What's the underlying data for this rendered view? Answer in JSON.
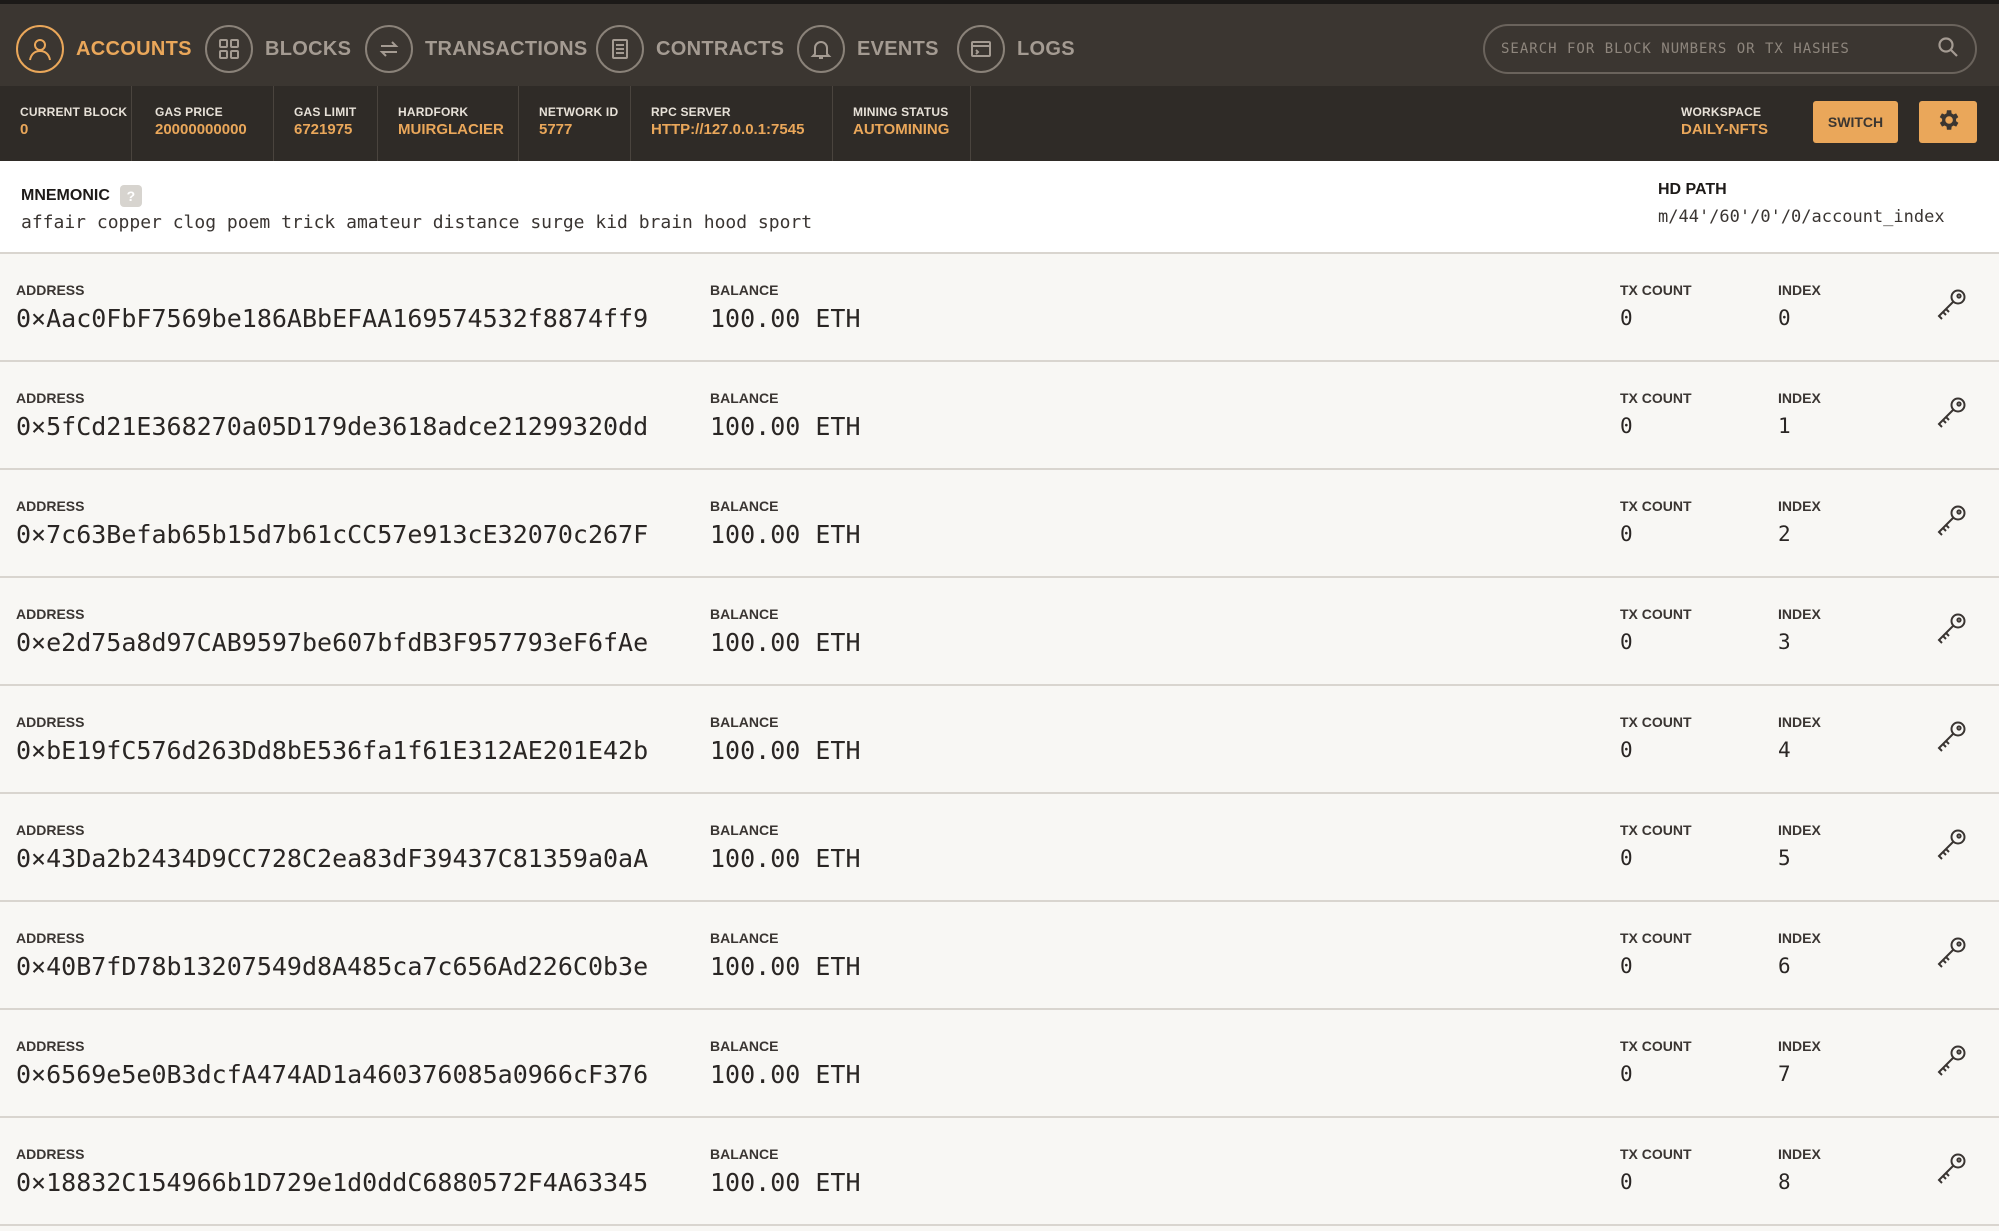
{
  "nav": {
    "items": [
      {
        "label": "Accounts",
        "icon": "user-icon",
        "active": true
      },
      {
        "label": "Blocks",
        "icon": "grid-icon",
        "active": false
      },
      {
        "label": "Transactions",
        "icon": "swap-icon",
        "active": false
      },
      {
        "label": "Contracts",
        "icon": "document-icon",
        "active": false
      },
      {
        "label": "Events",
        "icon": "bell-icon",
        "active": false
      },
      {
        "label": "Logs",
        "icon": "terminal-icon",
        "active": false
      }
    ],
    "search_placeholder": "Search for block numbers or tx hashes"
  },
  "status": {
    "current_block": {
      "label": "Current Block",
      "value": "0"
    },
    "gas_price": {
      "label": "Gas Price",
      "value": "20000000000"
    },
    "gas_limit": {
      "label": "Gas Limit",
      "value": "6721975"
    },
    "hardfork": {
      "label": "Hardfork",
      "value": "Muirglacier"
    },
    "network_id": {
      "label": "Network ID",
      "value": "5777"
    },
    "rpc_server": {
      "label": "RPC Server",
      "value": "HTTP://127.0.0.1:7545"
    },
    "mining_status": {
      "label": "Mining Status",
      "value": "Automining"
    },
    "workspace": {
      "label": "Workspace",
      "value": "DAILY-NFTS"
    },
    "switch_label": "Switch"
  },
  "mnemonic": {
    "label": "Mnemonic",
    "help": "?",
    "words": "affair copper clog poem trick amateur distance surge kid brain hood sport",
    "hd_path_label": "HD Path",
    "hd_path": "m/44'/60'/0'/0/account_index"
  },
  "columns": {
    "address": "Address",
    "balance": "Balance",
    "tx_count": "TX Count",
    "index": "Index"
  },
  "accounts": [
    {
      "address": "0×Aac0FbF7569be186ABbEFAA169574532f8874ff9",
      "balance": "100.00 ETH",
      "tx_count": "0",
      "index": "0"
    },
    {
      "address": "0×5fCd21E368270a05D179de3618adce21299320dd",
      "balance": "100.00 ETH",
      "tx_count": "0",
      "index": "1"
    },
    {
      "address": "0×7c63Befab65b15d7b61cCC57e913cE32070c267F",
      "balance": "100.00 ETH",
      "tx_count": "0",
      "index": "2"
    },
    {
      "address": "0×e2d75a8d97CAB9597be607bfdB3F957793eF6fAe",
      "balance": "100.00 ETH",
      "tx_count": "0",
      "index": "3"
    },
    {
      "address": "0×bE19fC576d263Dd8bE536fa1f61E312AE201E42b",
      "balance": "100.00 ETH",
      "tx_count": "0",
      "index": "4"
    },
    {
      "address": "0×43Da2b2434D9CC728C2ea83dF39437C81359a0aA",
      "balance": "100.00 ETH",
      "tx_count": "0",
      "index": "5"
    },
    {
      "address": "0×40B7fD78b13207549d8A485ca7c656Ad226C0b3e",
      "balance": "100.00 ETH",
      "tx_count": "0",
      "index": "6"
    },
    {
      "address": "0×6569e5e0B3dcfA474AD1a460376085a0966cF376",
      "balance": "100.00 ETH",
      "tx_count": "0",
      "index": "7"
    },
    {
      "address": "0×18832C154966b1D729e1d0ddC6880572F4A63345",
      "balance": "100.00 ETH",
      "tx_count": "0",
      "index": "8"
    }
  ],
  "colors": {
    "accent": "#eaa75a",
    "nav_bg": "#3b3631",
    "status_bg": "#2f2b27"
  }
}
